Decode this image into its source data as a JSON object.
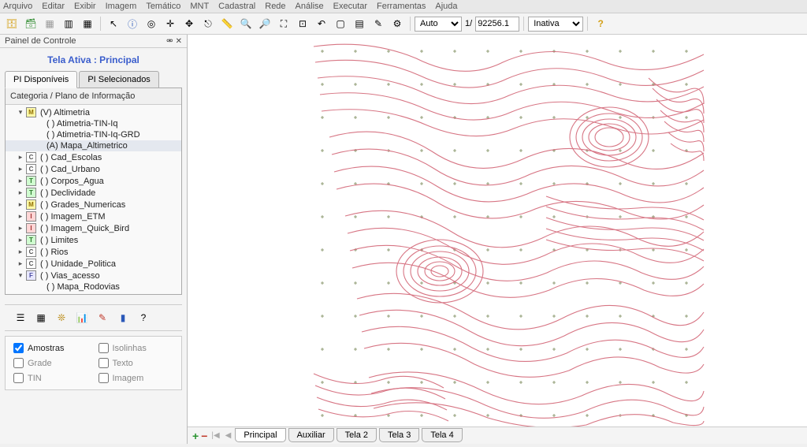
{
  "menubar": [
    "Arquivo",
    "Editar",
    "Exibir",
    "Imagem",
    "Temático",
    "MNT",
    "Cadastral",
    "Rede",
    "Análise",
    "Executar",
    "Ferramentas",
    "Ajuda"
  ],
  "toolbar": {
    "scale_mode": "Auto",
    "scale_ratio": "1/",
    "scale_value": "92256.1",
    "state": "Inativa"
  },
  "panel": {
    "title": "Painel de Controle",
    "tela_label": "Tela Ativa : Principal",
    "tabs": [
      "PI Disponíveis",
      "PI Selecionados"
    ],
    "active_tab": 0,
    "tree_header": "Categoria / Plano de Informação",
    "tree": [
      {
        "exp": "▾",
        "cat": "M",
        "label": "(V) Altimetria",
        "ind": 1
      },
      {
        "exp": "",
        "cat": "",
        "label": "( ) Atimetria-TIN-Iq",
        "ind": 2
      },
      {
        "exp": "",
        "cat": "",
        "label": "( ) Atimetria-TIN-Iq-GRD",
        "ind": 2
      },
      {
        "exp": "",
        "cat": "",
        "label": "(A) Mapa_Altimetrico",
        "ind": 2,
        "sel": true
      },
      {
        "exp": "▸",
        "cat": "C",
        "label": "( ) Cad_Escolas",
        "ind": 1
      },
      {
        "exp": "▸",
        "cat": "C",
        "label": "( ) Cad_Urbano",
        "ind": 1
      },
      {
        "exp": "▸",
        "cat": "T",
        "label": "( ) Corpos_Agua",
        "ind": 1
      },
      {
        "exp": "▸",
        "cat": "T",
        "label": "( ) Declividade",
        "ind": 1
      },
      {
        "exp": "▸",
        "cat": "M",
        "label": "( ) Grades_Numericas",
        "ind": 1
      },
      {
        "exp": "▸",
        "cat": "I",
        "label": "( ) Imagem_ETM",
        "ind": 1
      },
      {
        "exp": "▸",
        "cat": "I",
        "label": "( ) Imagem_Quick_Bird",
        "ind": 1
      },
      {
        "exp": "▸",
        "cat": "T",
        "label": "( ) Limites",
        "ind": 1
      },
      {
        "exp": "▸",
        "cat": "C",
        "label": "( ) Rios",
        "ind": 1
      },
      {
        "exp": "▸",
        "cat": "C",
        "label": "( ) Unidade_Politica",
        "ind": 1
      },
      {
        "exp": "▾",
        "cat": "F",
        "label": "( ) Vias_acesso",
        "ind": 1
      },
      {
        "exp": "",
        "cat": "",
        "label": "( ) Mapa_Rodovias",
        "ind": 2
      }
    ],
    "checks": [
      {
        "label": "Amostras",
        "checked": true
      },
      {
        "label": "Isolinhas",
        "checked": false
      },
      {
        "label": "Grade",
        "checked": false
      },
      {
        "label": "Texto",
        "checked": false
      },
      {
        "label": "TIN",
        "checked": false
      },
      {
        "label": "Imagem",
        "checked": false
      }
    ]
  },
  "view_tabs": [
    "Principal",
    "Auxiliar",
    "Tela 2",
    "Tela 3",
    "Tela 4"
  ],
  "active_view_tab": 0
}
